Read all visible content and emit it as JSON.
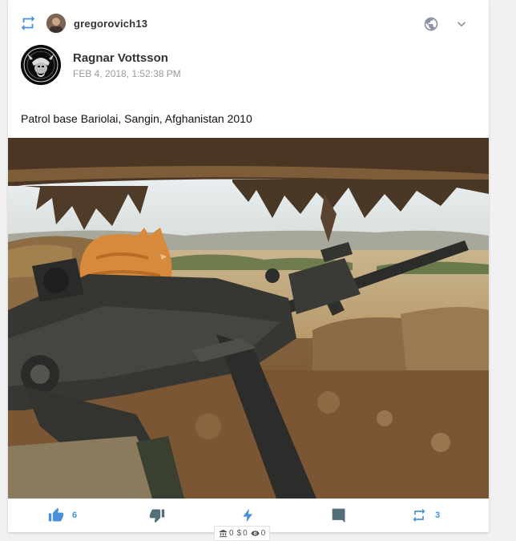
{
  "reminder": {
    "username": "gregorovich13"
  },
  "owner": {
    "name": "Ragnar Vottsson",
    "timestamp": "FEB 4, 2018, 1:52:38 PM"
  },
  "message": "Patrol base Bariolai, Sangin, Afghanistan 2010",
  "actions": {
    "thumbs_up_count": "6",
    "remind_count": "3"
  },
  "metrics": {
    "wire": "0",
    "dollars": "0",
    "views": "0"
  },
  "icons": {
    "remind": "remind-icon",
    "globe": "globe-icon",
    "chevron": "chevron-down-icon",
    "thumbs_up": "thumbs-up-icon",
    "thumbs_down": "thumbs-down-icon",
    "boost": "bolt-icon",
    "comment": "comment-icon",
    "bank": "bank-icon",
    "eye": "eye-icon"
  },
  "colors": {
    "accent": "#4a90d9",
    "icon_muted": "#8a96a3",
    "comment_icon": "#546e7a"
  }
}
